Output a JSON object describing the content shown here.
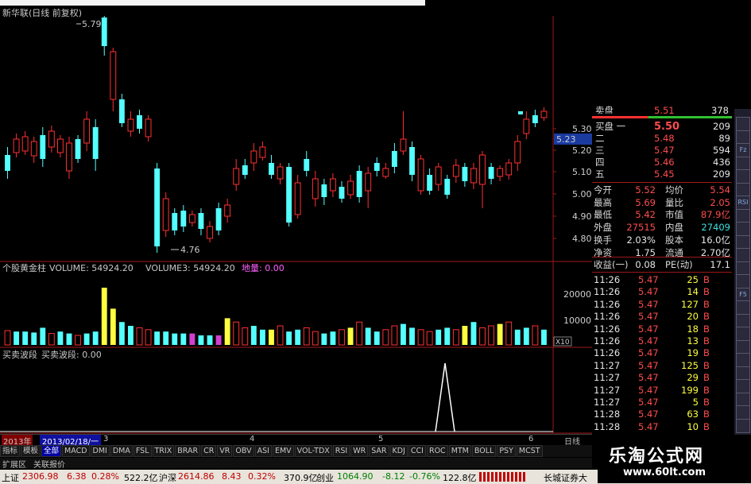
{
  "window": {
    "title": "新华联(日线 前复权)"
  },
  "price_chart": {
    "high_label": "5.79",
    "low_label": "4.76",
    "axis_ticks": [
      "5.30",
      "5.20",
      "5.10",
      "5.00",
      "4.90",
      "4.80"
    ],
    "current_price_tag": "5.23",
    "up_color": "#ff3030",
    "down_color": "#54ffff"
  },
  "volume_pane": {
    "indicator_name": "个股黄金柱",
    "vol_label": "VOLUME: 54924.20",
    "vol3_label": "VOLUME3: 54924.20",
    "dibao_label": "地量: 0.00",
    "ticks": [
      "20000",
      "10000"
    ],
    "unit": "X10"
  },
  "wave_pane": {
    "name": "买卖波段",
    "value_label": "买卖波段: 0.00"
  },
  "date_axis": {
    "year": "2013年",
    "cursor_date": "2013/02/18/一",
    "months": [
      "3",
      "4",
      "5",
      "6"
    ],
    "period": "日线"
  },
  "indicator_tabs": [
    "指标",
    "模板",
    "全部",
    "MACD",
    "DMI",
    "DMA",
    "FSL",
    "TRIX",
    "BRAR",
    "CR",
    "VR",
    "OBV",
    "ASI",
    "EMV",
    "VOL-TDX",
    "RSI",
    "WR",
    "SAR",
    "KDJ",
    "CCI",
    "ROC",
    "MTM",
    "BOLL",
    "PSY",
    "MCST"
  ],
  "subtabs": [
    "扩展区",
    "关联报价"
  ],
  "quote": {
    "top_partial": {
      "label": "卖盘",
      "price": "5.51",
      "vol": "378"
    },
    "bids": [
      {
        "label": "买盘 一",
        "price": "5.50",
        "vol": "209"
      },
      {
        "label": "二",
        "price": "5.48",
        "vol": "89"
      },
      {
        "label": "三",
        "price": "5.47",
        "vol": "594"
      },
      {
        "label": "四",
        "price": "5.46",
        "vol": "436"
      },
      {
        "label": "五",
        "price": "5.45",
        "vol": "209"
      }
    ],
    "stats": [
      {
        "l1": "今开",
        "v1": "5.52",
        "l2": "均价",
        "v2": "5.54"
      },
      {
        "l1": "最高",
        "v1": "5.69",
        "l2": "量比",
        "v2": "2.05"
      },
      {
        "l1": "最低",
        "v1": "5.42",
        "l2": "市值",
        "v2": "87.9亿"
      },
      {
        "l1": "外盘",
        "v1": "27515",
        "l2": "内盘",
        "v2": "27409"
      },
      {
        "l1": "换手",
        "v1": "2.03%",
        "l2": "股本",
        "v2": "16.0亿"
      },
      {
        "l1": "净资",
        "v1": "1.75",
        "l2": "流通",
        "v2": "2.70亿"
      },
      {
        "l1": "收益(一)",
        "v1": "0.08",
        "l2": "PE(动)",
        "v2": "17.1"
      }
    ],
    "ticks": [
      {
        "time": "11:26",
        "price": "5.47",
        "vol": "25",
        "side": "B"
      },
      {
        "time": "11:26",
        "price": "5.47",
        "vol": "14",
        "side": "B"
      },
      {
        "time": "11:26",
        "price": "5.47",
        "vol": "127",
        "side": "B"
      },
      {
        "time": "11:26",
        "price": "5.47",
        "vol": "20",
        "side": "B"
      },
      {
        "time": "11:26",
        "price": "5.47",
        "vol": "18",
        "side": "B"
      },
      {
        "time": "11:26",
        "price": "5.47",
        "vol": "13",
        "side": "B"
      },
      {
        "time": "11:26",
        "price": "5.47",
        "vol": "19",
        "side": "B"
      },
      {
        "time": "11:27",
        "price": "5.47",
        "vol": "125",
        "side": "B"
      },
      {
        "time": "11:27",
        "price": "5.47",
        "vol": "29",
        "side": "B"
      },
      {
        "time": "11:27",
        "price": "5.47",
        "vol": "199",
        "side": "B"
      },
      {
        "time": "11:27",
        "price": "5.47",
        "vol": "5",
        "side": "B"
      },
      {
        "time": "11:28",
        "price": "5.47",
        "vol": "63",
        "side": "B"
      },
      {
        "time": "11:28",
        "price": "5.47",
        "vol": "10",
        "side": "B"
      }
    ]
  },
  "right_toolbar": [
    "Fz",
    "RSI",
    "F5"
  ],
  "status": {
    "sh_label": "上证",
    "sh_index": "2306.98",
    "sh_change": "6.38",
    "sh_pct": "0.28%",
    "sh_amount": "522.2亿",
    "hs_label": "沪深",
    "hs_index": "2614.86",
    "hs_change": "8.43",
    "hs_pct": "0.32%",
    "hs_amount": "370.9亿",
    "cy_label": "创业",
    "cy_index": "1064.90",
    "cy_change": "-8.12",
    "cy_pct": "-0.76%",
    "cy_amount": "122.8亿",
    "broker": "长城证券大"
  },
  "watermark": {
    "name": "乐淘公式网",
    "url": "www.60lt.com"
  }
}
